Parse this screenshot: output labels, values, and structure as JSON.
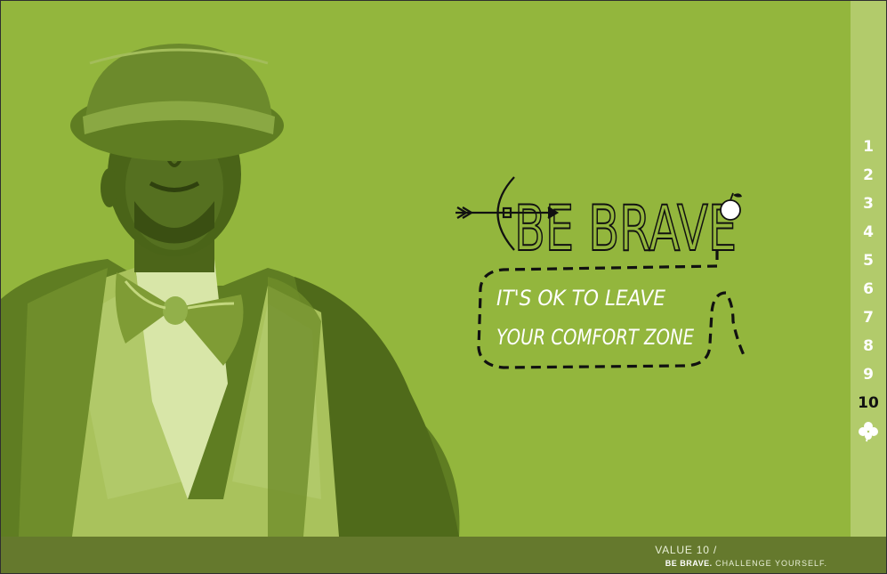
{
  "colors": {
    "background": "#93b63d",
    "sidebar": "#b2cb6b",
    "footer": "#65792d",
    "active_nav": "#111111",
    "nav": "#ffffff"
  },
  "hero": {
    "title": "BE BRAVE",
    "subtitle_line1": "IT'S OK TO LEAVE",
    "subtitle_line2": "YOUR COMFORT ZONE"
  },
  "nav": {
    "items": [
      "1",
      "2",
      "3",
      "4",
      "5",
      "6",
      "7",
      "8",
      "9",
      "10"
    ],
    "active": "10",
    "clover_icon": "clover-icon"
  },
  "footer": {
    "value_label": "VALUE 10 /",
    "strong": "BE BRAVE.",
    "rest": " CHALLENGE YOURSELF."
  }
}
